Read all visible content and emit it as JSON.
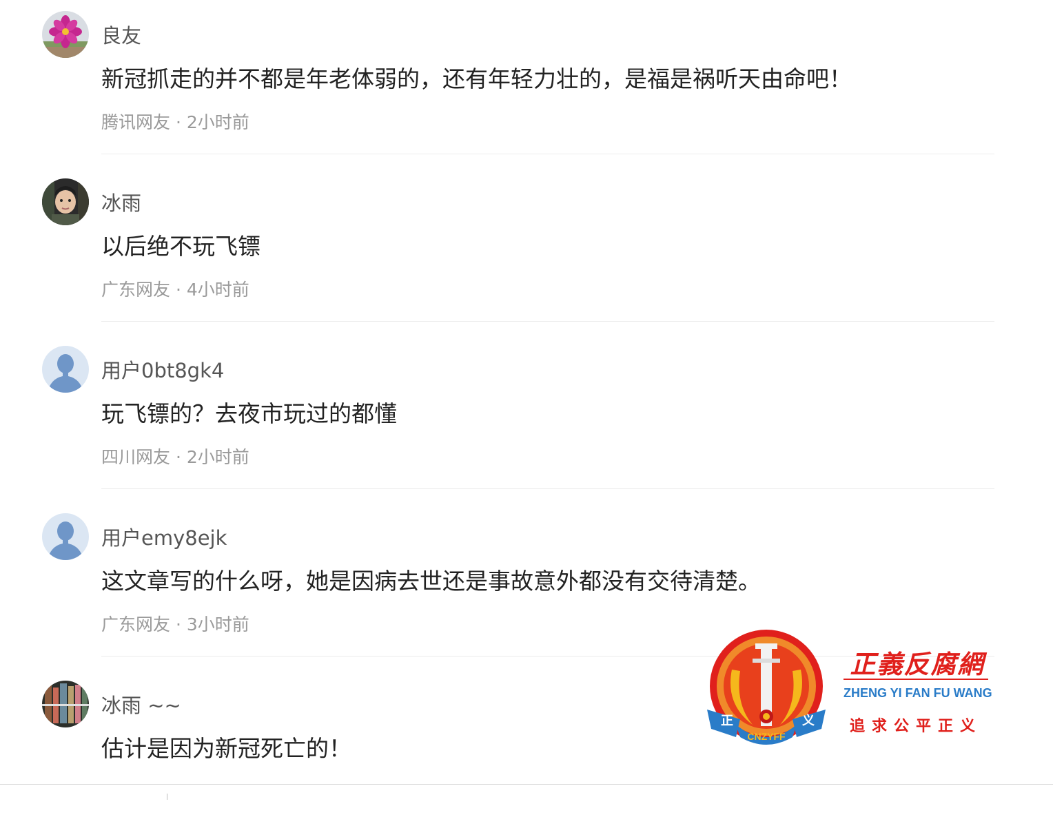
{
  "comments": [
    {
      "username": "良友",
      "text": "新冠抓走的并不都是年老体弱的，还有年轻力壮的，是福是祸听天由命吧！",
      "meta": "腾讯网友 · 2小时前",
      "avatar": "flower-avatar"
    },
    {
      "username": "冰雨",
      "text": "以后绝不玩飞镖",
      "meta": "广东网友 · 4小时前",
      "avatar": "child-photo-avatar"
    },
    {
      "username": "用户0bt8gk4",
      "text": "玩飞镖的？去夜市玩过的都懂",
      "meta": "四川网友 · 2小时前",
      "avatar": "default-user-avatar"
    },
    {
      "username": "用户emy8ejk",
      "text": "这文章写的什么呀，她是因病去世还是事故意外都没有交待清楚。",
      "meta": "广东网友 · 3小时前",
      "avatar": "default-user-avatar"
    },
    {
      "username": "冰雨 ~~",
      "text": "估计是因为新冠死亡的！",
      "meta": "",
      "avatar": "bookshelf-avatar"
    }
  ],
  "watermark": {
    "title": "正義反腐網",
    "pinyin": "ZHENG YI FAN FU WANG",
    "slogan": "追求公平正义",
    "emblem_text": "CNZYFF",
    "emblem_left_char": "正",
    "emblem_right_char": "义",
    "colors": {
      "red": "#e0201c",
      "blue": "#2a7cc8",
      "gold": "#f5b81c"
    }
  },
  "colors": {
    "username": "#555555",
    "text": "#222222",
    "meta": "#9a9a9a",
    "avatar_default_bg": "#dbe6f3",
    "avatar_default_fg": "#6f96c8"
  }
}
